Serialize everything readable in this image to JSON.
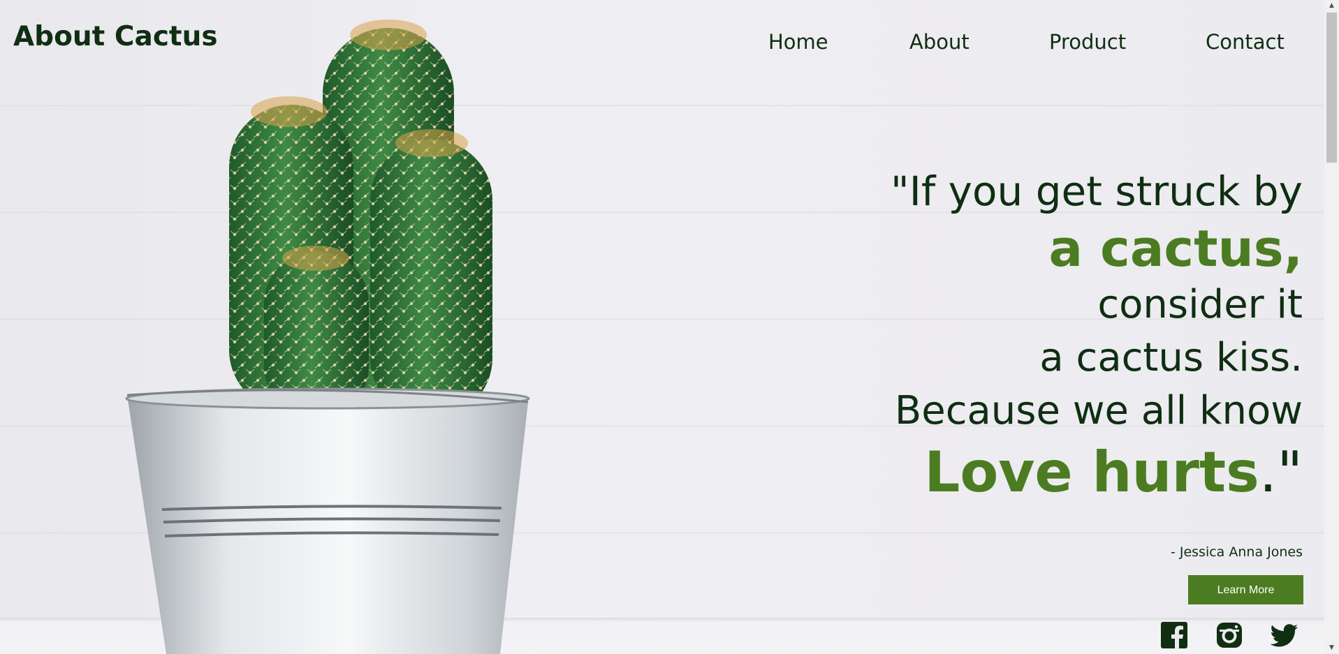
{
  "header": {
    "logo": "About Cactus",
    "nav": [
      "Home",
      "About",
      "Product",
      "Contact"
    ]
  },
  "hero": {
    "quote": {
      "line1": "\"If you get struck by",
      "line2": "a cactus,",
      "line3": "consider it",
      "line4": "a cactus kiss.",
      "line5": "Because we all know",
      "line6_emphasis": "Love hurts",
      "line6_end": ".\""
    },
    "author": "- Jessica Anna Jones",
    "cta": "Learn More"
  },
  "social": {
    "icons": [
      "facebook-icon",
      "instagram-icon",
      "twitter-icon"
    ]
  },
  "colors": {
    "accent": "#4c7c22",
    "text": "#0f2e12",
    "background": "#ebe9ee"
  }
}
